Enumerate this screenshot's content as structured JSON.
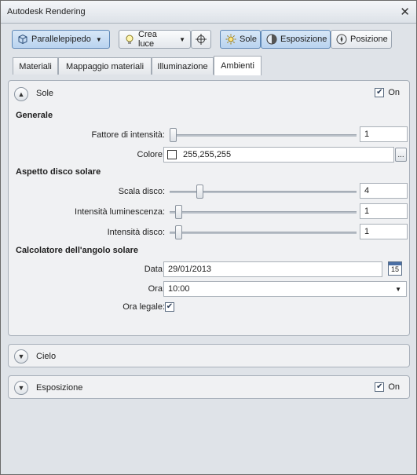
{
  "window": {
    "title": "Autodesk Rendering",
    "close_glyph": "✕"
  },
  "toolbar": {
    "shape_button": "Parallelepipedo",
    "create_light_button": "Crea luce",
    "sun_button": "Sole",
    "exposure_button": "Esposizione",
    "position_button": "Posizione"
  },
  "tabs": [
    "Materiali",
    "Mappaggio materiali",
    "Illuminazione",
    "Ambienti"
  ],
  "sun_panel": {
    "title": "Sole",
    "on_label": "On",
    "on_checked": true,
    "general": {
      "heading": "Generale",
      "intensity_label": "Fattore di intensità:",
      "intensity_value": "1",
      "intensity_level": 0.0,
      "color_label": "Colore:",
      "color_value": "255,255,255",
      "color_button": "..."
    },
    "disk": {
      "heading": "Aspetto disco solare",
      "scale_label": "Scala disco:",
      "scale_value": "4",
      "scale_level": 0.15,
      "glow_label": "Intensità luminescenza:",
      "glow_value": "1",
      "glow_level": 0.03,
      "disk_intensity_label": "Intensità disco:",
      "disk_intensity_value": "1",
      "disk_intensity_level": 0.03
    },
    "angle": {
      "heading": "Calcolatore dell'angolo solare",
      "date_label": "Data:",
      "date_value": "29/01/2013",
      "calendar_day": "15",
      "time_label": "Ora:",
      "time_value": "10:00",
      "dst_label": "Ora legale:",
      "dst_checked": true
    }
  },
  "sky_panel": {
    "title": "Cielo"
  },
  "exposure_panel": {
    "title": "Esposizione",
    "on_label": "On",
    "on_checked": true
  },
  "colors": {
    "accent": "#5d87b6",
    "panel_bg": "#f0f1f3",
    "window_bg": "#dfe3e8"
  }
}
